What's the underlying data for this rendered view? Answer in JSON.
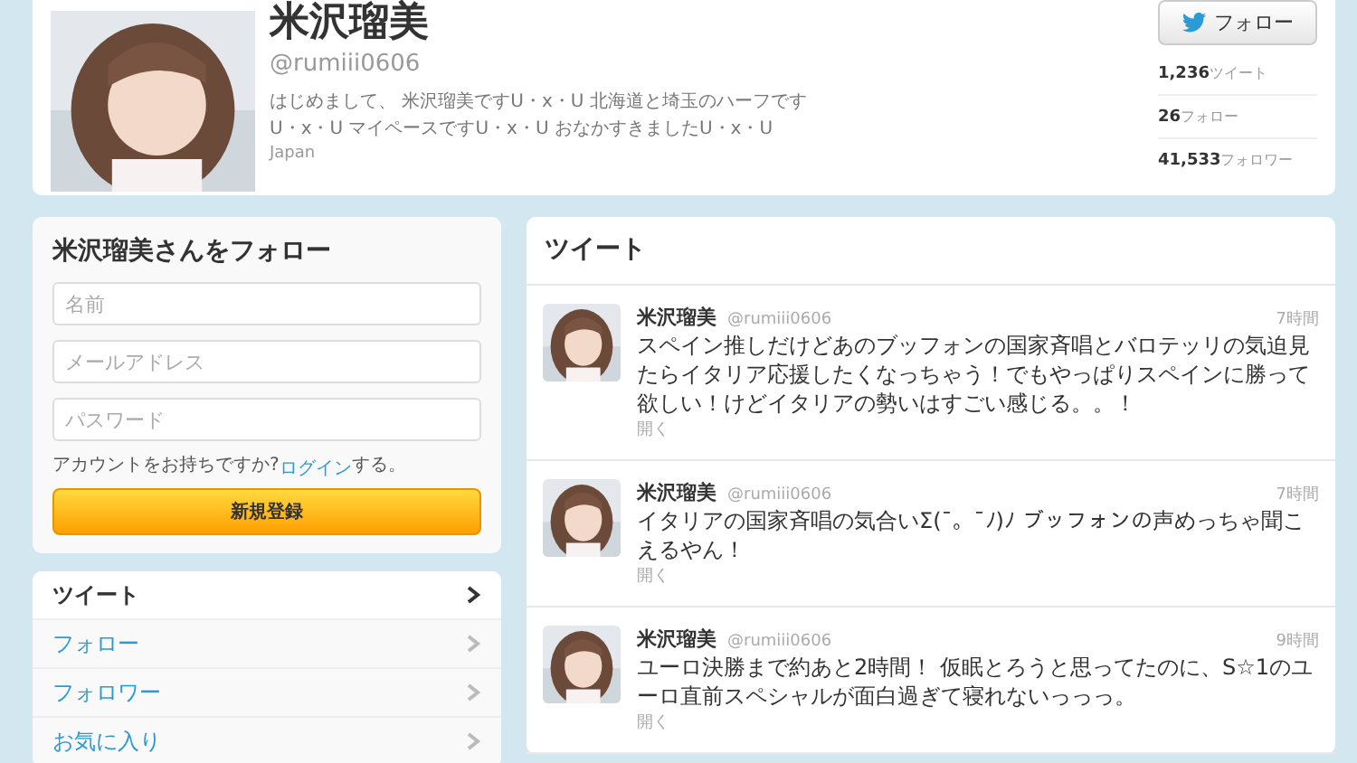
{
  "profile": {
    "name": "米沢瑠美",
    "handle": "@rumiii0606",
    "bio": [
      "はじめまして、 米沢瑠美ですU・x・U 北海道と埼玉のハーフです",
      "U・x・U マイペースですU・x・U おなかすきましたU・x・U"
    ],
    "location": "Japan",
    "follow_button": "フォロー",
    "stats": [
      {
        "value": "1,236",
        "label": "ツイート"
      },
      {
        "value": "26",
        "label": "フォロー"
      },
      {
        "value": "41,533",
        "label": "フォロワー"
      }
    ]
  },
  "signup": {
    "title": "米沢瑠美さんをフォロー",
    "fields": [
      {
        "placeholder": "名前"
      },
      {
        "placeholder": "メールアドレス"
      },
      {
        "placeholder": "パスワード"
      }
    ],
    "login_prompt": "アカウントをお持ちですか?",
    "login_link": "ログイン",
    "login_suffix": "する。",
    "button": "新規登録"
  },
  "nav": [
    {
      "label": "ツイート",
      "selected": true
    },
    {
      "label": "フォロー",
      "selected": false
    },
    {
      "label": "フォロワー",
      "selected": false
    },
    {
      "label": "お気に入り",
      "selected": false
    }
  ],
  "timeline": {
    "title": "ツイート",
    "tweets": [
      {
        "name": "米沢瑠美",
        "handle": "@rumiii0606",
        "time": "7時間",
        "text": "スペイン推しだけどあのブッフォンの国家斉唱とバロテッリの気迫見たらイタリア応援したくなっちゃう！でもやっぱりスペインに勝って欲しい！けどイタリアの勢いはすごい感じる。。！",
        "action": "開く"
      },
      {
        "name": "米沢瑠美",
        "handle": "@rumiii0606",
        "time": "7時間",
        "text": "イタリアの国家斉唱の気合いΣ(¯。¯ﾉ)ﾉ ブッフォンの声めっちゃ聞こえるやん！",
        "action": "開く"
      },
      {
        "name": "米沢瑠美",
        "handle": "@rumiii0606",
        "time": "9時間",
        "text": "ユーロ決勝まで約あと2時間！ 仮眠とろうと思ってたのに、S☆1のユーロ直前スペシャルが面白過ぎて寝れないっっっ。",
        "action": "開く"
      }
    ]
  }
}
